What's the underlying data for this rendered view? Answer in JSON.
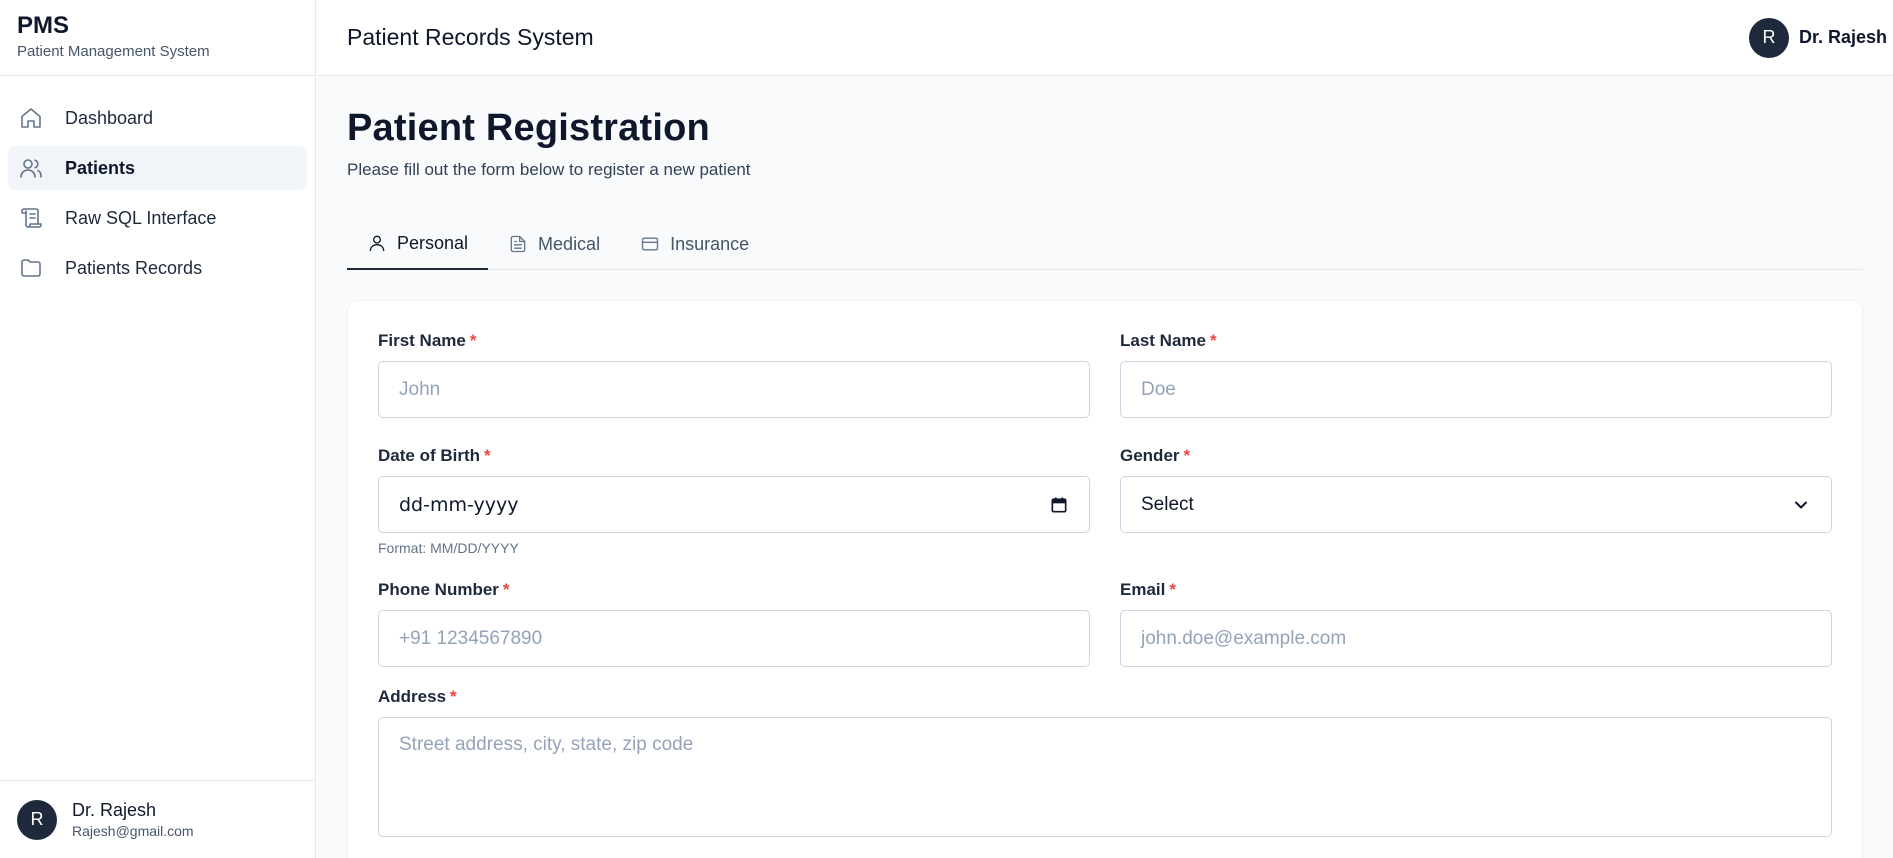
{
  "brand": {
    "title": "PMS",
    "subtitle": "Patient Management System"
  },
  "sidebar": {
    "items": [
      {
        "label": "Dashboard",
        "icon": "home-icon",
        "active": false
      },
      {
        "label": "Patients",
        "icon": "users-icon",
        "active": true
      },
      {
        "label": "Raw SQL Interface",
        "icon": "scroll-icon",
        "active": false
      },
      {
        "label": "Patients Records",
        "icon": "folder-icon",
        "active": false
      }
    ],
    "user": {
      "initial": "R",
      "name": "Dr. Rajesh",
      "email": "Rajesh@gmail.com"
    }
  },
  "topbar": {
    "title": "Patient Records System",
    "user_initial": "R",
    "user_name": "Dr. Rajesh"
  },
  "page": {
    "title": "Patient Registration",
    "subtitle": "Please fill out the form below to register a new patient"
  },
  "tabs": [
    {
      "label": "Personal",
      "icon": "user-icon",
      "active": true
    },
    {
      "label": "Medical",
      "icon": "document-icon",
      "active": false
    },
    {
      "label": "Insurance",
      "icon": "card-icon",
      "active": false
    }
  ],
  "form": {
    "required_mark": "*",
    "first_name": {
      "label": "First Name",
      "placeholder": "John"
    },
    "last_name": {
      "label": "Last Name",
      "placeholder": "Doe"
    },
    "dob": {
      "label": "Date of Birth",
      "value": "dd-mm-yyyy",
      "hint": "Format: MM/DD/YYYY"
    },
    "gender": {
      "label": "Gender",
      "value": "Select"
    },
    "phone": {
      "label": "Phone Number",
      "placeholder": "+91 1234567890"
    },
    "email": {
      "label": "Email",
      "placeholder": "john.doe@example.com"
    },
    "address": {
      "label": "Address",
      "placeholder": "Street address, city, state, zip code"
    }
  },
  "colors": {
    "accent": "#1e293b",
    "required": "#ef4444",
    "background": "#f8fafc"
  }
}
